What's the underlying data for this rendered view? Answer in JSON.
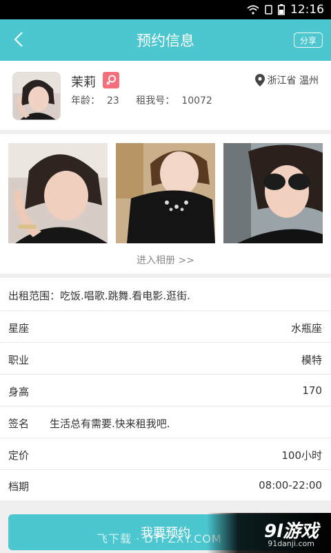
{
  "status_bar": {
    "time": "12:16"
  },
  "header": {
    "title": "预约信息",
    "share_label": "分享"
  },
  "profile": {
    "name": "茉莉",
    "age_label": "年龄：",
    "age": "23",
    "id_label": "租我号：",
    "id": "10072",
    "location": "浙江省  温州"
  },
  "gallery": {
    "album_link": "进入相册 >>"
  },
  "rental_scope": "出租范围：吃饭.唱歌.跳舞.看电影.逛街.",
  "details": [
    {
      "label": "星座",
      "value": "水瓶座"
    },
    {
      "label": "职业",
      "value": "模特"
    },
    {
      "label": "身高",
      "value": "170"
    },
    {
      "label": "签名",
      "value": "生活总有需要.快来租我吧."
    },
    {
      "label": "定价",
      "value": "100小时"
    },
    {
      "label": "档期",
      "value": "08:00-22:00"
    }
  ],
  "book_button": "我要预约",
  "watermarks": {
    "left": "飞下载 · DTFZXY.COM",
    "logo": "9l游戏",
    "logo_url": "91danji.com"
  },
  "colors": {
    "accent": "#4cc6cf",
    "gender_badge": "#f36f7b"
  }
}
